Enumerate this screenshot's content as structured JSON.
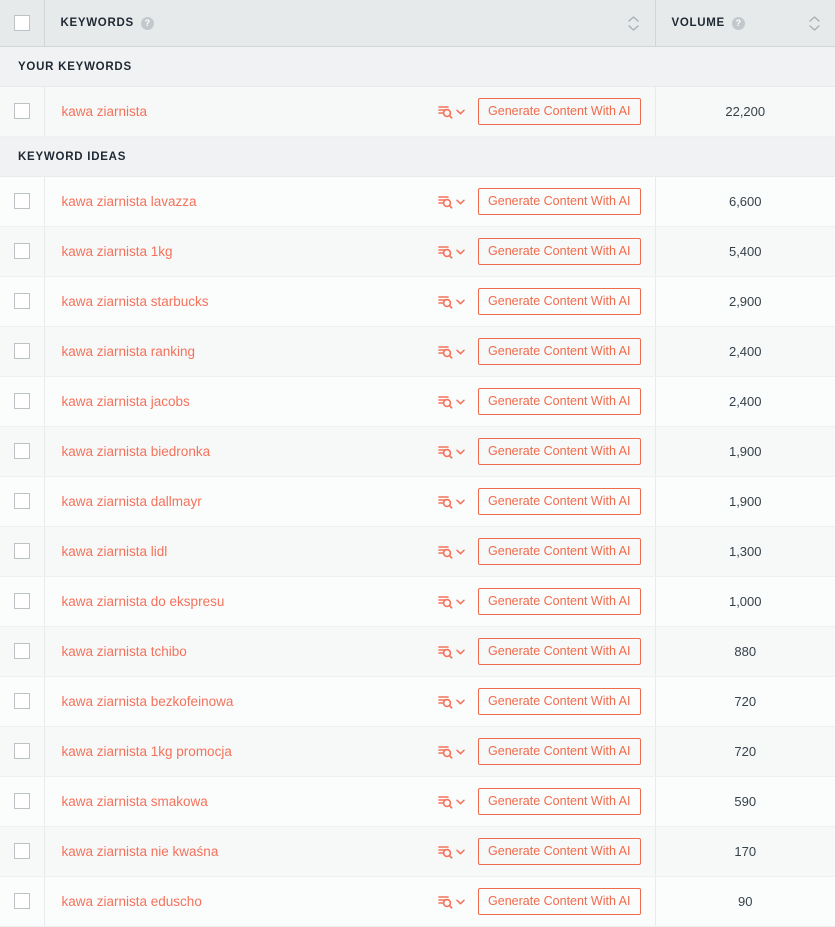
{
  "table": {
    "header": {
      "select_all_checkbox": "",
      "columns": [
        {
          "label": "KEYWORDS",
          "help_icon": "question-mark-icon",
          "help_glyph": "?",
          "sort_icon": "sort-chevrons-icon"
        },
        {
          "label": "VOLUME",
          "help_icon": "question-mark-icon",
          "help_glyph": "?",
          "sort_icon": "sort-chevrons-icon"
        }
      ]
    },
    "row_action": {
      "serp_icon": "serp-analysis-search-icon",
      "dropdown_icon": "chevron-down-icon",
      "generate_label": "Generate Content With AI"
    },
    "sections": [
      {
        "title": "YOUR KEYWORDS",
        "rows": [
          {
            "keyword": "kawa ziarnista",
            "volume": "22,200"
          }
        ]
      },
      {
        "title": "KEYWORD IDEAS",
        "rows": [
          {
            "keyword": "kawa ziarnista lavazza",
            "volume": "6,600"
          },
          {
            "keyword": "kawa ziarnista 1kg",
            "volume": "5,400"
          },
          {
            "keyword": "kawa ziarnista starbucks",
            "volume": "2,900"
          },
          {
            "keyword": "kawa ziarnista ranking",
            "volume": "2,400"
          },
          {
            "keyword": "kawa ziarnista jacobs",
            "volume": "2,400"
          },
          {
            "keyword": "kawa ziarnista biedronka",
            "volume": "1,900"
          },
          {
            "keyword": "kawa ziarnista dallmayr",
            "volume": "1,900"
          },
          {
            "keyword": "kawa ziarnista lidl",
            "volume": "1,300"
          },
          {
            "keyword": "kawa ziarnista do ekspresu",
            "volume": "1,000"
          },
          {
            "keyword": "kawa ziarnista tchibo",
            "volume": "880"
          },
          {
            "keyword": "kawa ziarnista bezkofeinowa",
            "volume": "720"
          },
          {
            "keyword": "kawa ziarnista 1kg promocja",
            "volume": "720"
          },
          {
            "keyword": "kawa ziarnista smakowa",
            "volume": "590"
          },
          {
            "keyword": "kawa ziarnista nie kwaśna",
            "volume": "170"
          },
          {
            "keyword": "kawa ziarnista eduscho",
            "volume": "90"
          }
        ]
      }
    ]
  },
  "colors": {
    "accent": "#f4725b",
    "button_border": "#ee6b4d",
    "header_bg": "#e7eaeb",
    "section_bg": "#f1f2f4",
    "row_odd_bg": "#f7f8f8",
    "row_even_bg": "#fbfcfc",
    "text": "#1f2933",
    "muted": "#c3c8cc"
  }
}
